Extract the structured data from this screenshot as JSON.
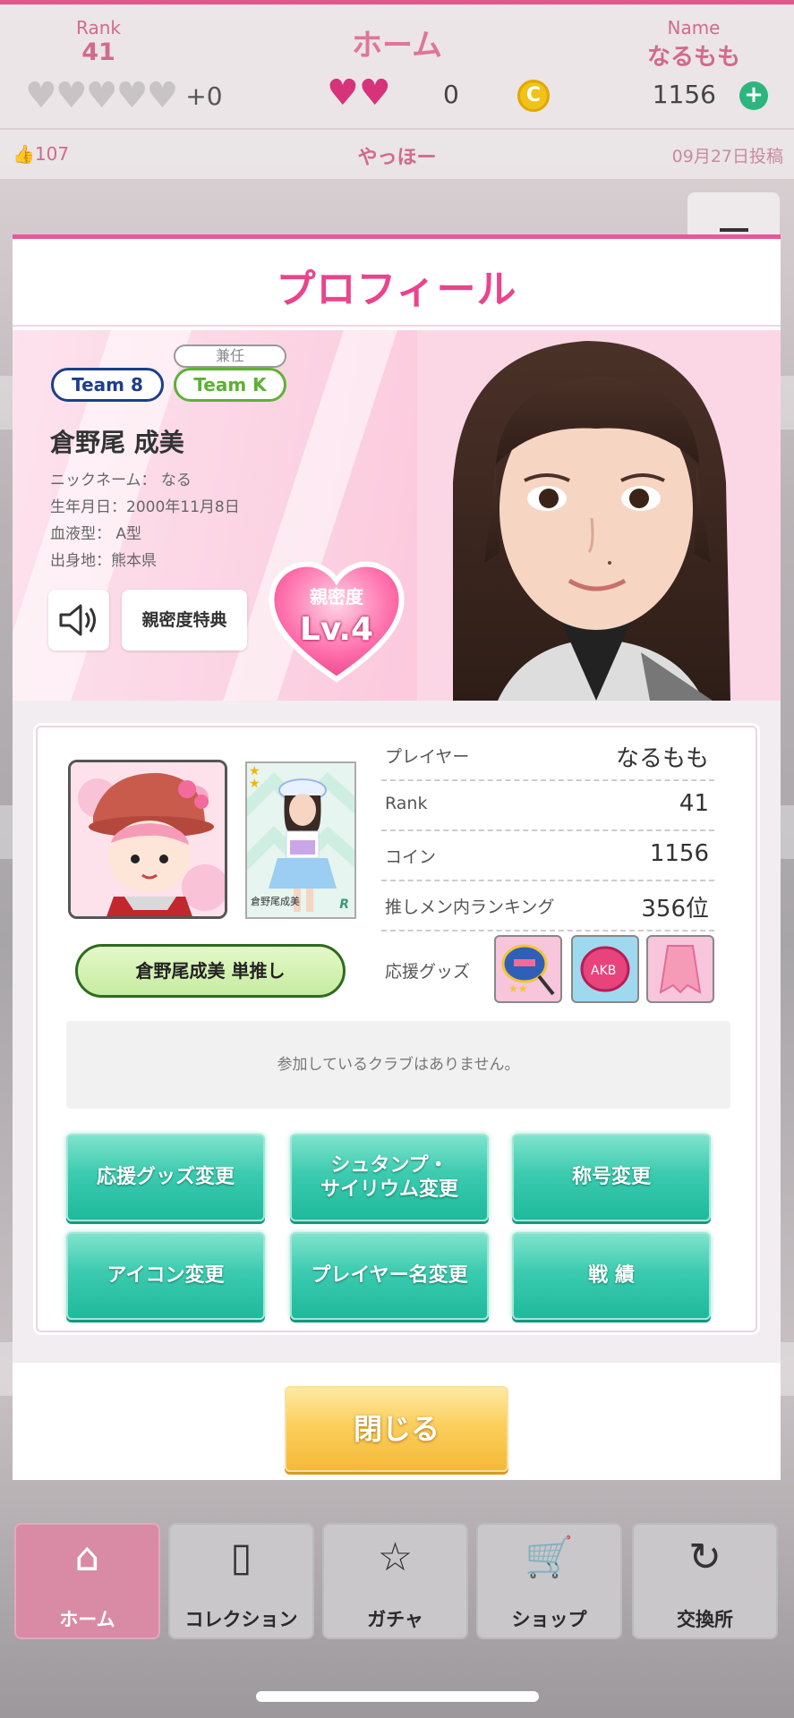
{
  "header": {
    "rank_label": "Rank",
    "rank_value": "41",
    "title": "ホーム",
    "name_label": "Name",
    "name_value": "なるもも",
    "heart_plus": "+0",
    "love_count": "0",
    "coin_symbol": "C",
    "coin_count": "1156",
    "plus_symbol": "+",
    "likes": "107",
    "greeting": "やっほー",
    "post_date": "09月27日投稿"
  },
  "modal": {
    "title": "プロフィール",
    "profile": {
      "team_main": "Team 8",
      "concurrent_label": "兼任",
      "team_concurrent": "Team K",
      "name": "倉野尾 成美",
      "nickname": "ニックネーム：  なる",
      "birthday": "生年月日：2000年11月8日",
      "blood_type": "血液型：  A型",
      "birthplace": "出身地：熊本県",
      "perk_button": "親密度特典",
      "intimacy_label": "親密度",
      "intimacy_level": "Lv.4"
    },
    "player": {
      "card_caption": "倉野尾成美",
      "card_rarity": "R",
      "oshi_button": "倉野尾成美 単推し",
      "stats": [
        {
          "key": "プレイヤー",
          "value": "なるもも"
        },
        {
          "key": "Rank",
          "value": "41"
        },
        {
          "key": "コイン",
          "value": "1156"
        },
        {
          "key": "推しメン内ランキング",
          "value": "356位"
        }
      ],
      "goods_label": "応援グッズ",
      "club_note": "参加しているクラブはありません。"
    },
    "buttons": [
      "応援グッズ変更",
      "シュタンプ・\nサイリウム変更",
      "称号変更",
      "アイコン変更",
      "プレイヤー名変更",
      "戦 績"
    ],
    "close_button": "閉じる"
  },
  "nav": [
    {
      "label": "ホーム",
      "icon": "home-icon"
    },
    {
      "label": "コレクション",
      "icon": "notebook-icon"
    },
    {
      "label": "ガチャ",
      "icon": "star-card-icon"
    },
    {
      "label": "ショップ",
      "icon": "cart-icon"
    },
    {
      "label": "交換所",
      "icon": "exchange-icon"
    }
  ],
  "colors": {
    "accent_pink": "#e8458d",
    "teal_button": "#3ccbb0",
    "gold_button": "#fbcf5c"
  }
}
